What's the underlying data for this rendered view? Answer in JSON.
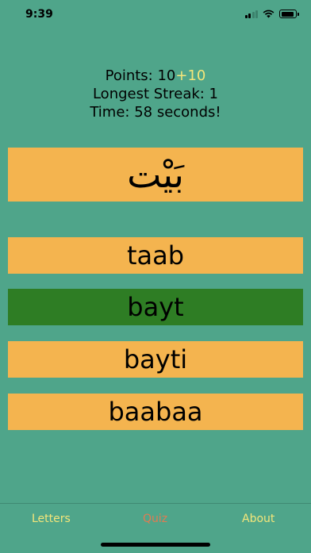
{
  "status": {
    "time": "9:39"
  },
  "stats": {
    "points_label": "Points: ",
    "points_value": "10",
    "points_bonus": "+10",
    "longest_streak": "Longest Streak: 1",
    "time": "Time: 58 seconds!"
  },
  "quiz": {
    "arabic_word": "بَيْت",
    "options": [
      "taab",
      "bayt",
      "bayti",
      "baabaa"
    ],
    "correct_index": 1
  },
  "tabs": [
    {
      "label": "Letters",
      "active": false
    },
    {
      "label": "Quiz",
      "active": true
    },
    {
      "label": "About",
      "active": false
    }
  ],
  "colors": {
    "background": "#4fa58a",
    "card": "#f4b44f",
    "correct": "#2e7d24",
    "bonus_text": "#f4e67a",
    "active_tab": "#e07b52"
  },
  "icons": [
    "cellular-signal-icon",
    "wifi-icon",
    "battery-icon"
  ]
}
